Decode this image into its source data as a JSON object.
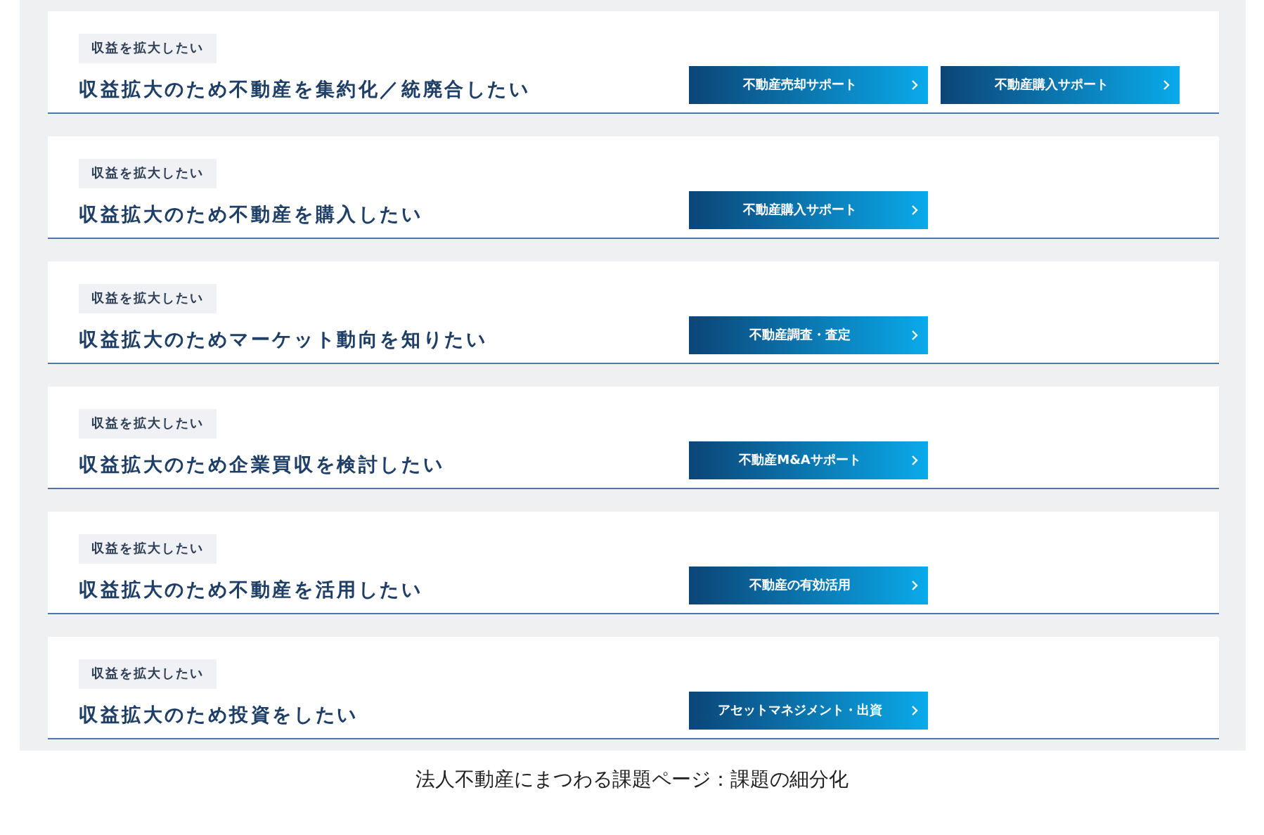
{
  "cards": [
    {
      "tag": "収益を拡大したい",
      "title": "収益拡大のため不動産を集約化／統廃合したい",
      "buttons": [
        "不動産売却サポート",
        "不動産購入サポート"
      ]
    },
    {
      "tag": "収益を拡大したい",
      "title": "収益拡大のため不動産を購入したい",
      "buttons": [
        "不動産購入サポート"
      ]
    },
    {
      "tag": "収益を拡大したい",
      "title": "収益拡大のためマーケット動向を知りたい",
      "buttons": [
        "不動産調査・査定"
      ]
    },
    {
      "tag": "収益を拡大したい",
      "title": "収益拡大のため企業買収を検討したい",
      "buttons": [
        "不動産M&Aサポート"
      ]
    },
    {
      "tag": "収益を拡大したい",
      "title": "収益拡大のため不動産を活用したい",
      "buttons": [
        "不動産の有効活用"
      ]
    },
    {
      "tag": "収益を拡大したい",
      "title": "収益拡大のため投資をしたい",
      "buttons": [
        "アセットマネジメント・出資"
      ]
    }
  ],
  "caption": "法人不動産にまつわる課題ページ：課題の細分化"
}
